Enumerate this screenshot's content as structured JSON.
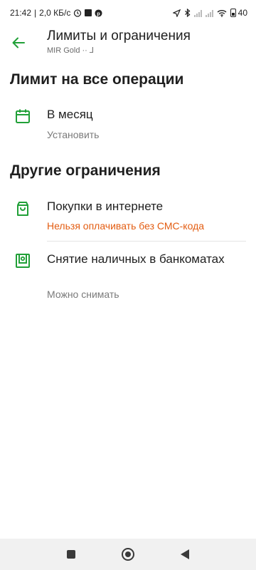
{
  "status_bar": {
    "time": "21:42",
    "net_speed": "2,0 КБ/с",
    "battery": "40"
  },
  "app_bar": {
    "title": "Лимиты и ограничения",
    "subtitle": "MIR Gold ·· ⅃"
  },
  "section_limits": {
    "heading": "Лимит на все операции",
    "items": [
      {
        "title": "В месяц",
        "subtitle": "Установить",
        "icon": "calendar-icon"
      }
    ]
  },
  "section_other": {
    "heading": "Другие ограничения",
    "items": [
      {
        "title": "Покупки в интернете",
        "subtitle": "Нельзя оплачивать без СМС-кода",
        "icon": "shopping-bag-icon",
        "subtitle_color": "#e35d12"
      },
      {
        "title": "Снятие наличных в банкоматах",
        "subtitle": "Можно снимать",
        "icon": "atm-icon"
      }
    ]
  },
  "colors": {
    "accent": "#21a038",
    "warning": "#e35d12"
  }
}
